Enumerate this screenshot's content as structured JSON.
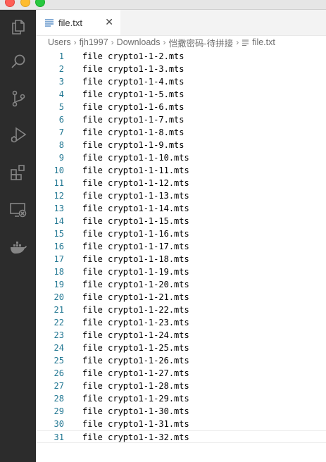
{
  "window": {
    "controls": [
      "close",
      "minimize",
      "maximize"
    ]
  },
  "activity_bar": {
    "icons": [
      "explorer-icon",
      "search-icon",
      "source-control-icon",
      "run-debug-icon",
      "extensions-icon",
      "remote-explorer-icon",
      "docker-icon"
    ]
  },
  "tab": {
    "label": "file.txt",
    "close_glyph": "✕"
  },
  "breadcrumb": {
    "items": [
      "Users",
      "fjh1997",
      "Downloads",
      "恺撒密码-待拼接",
      "file.txt"
    ],
    "separator": "›"
  },
  "editor": {
    "lines": [
      {
        "n": "1",
        "text": "file crypto1-1-2.mts"
      },
      {
        "n": "2",
        "text": "file crypto1-1-3.mts"
      },
      {
        "n": "3",
        "text": "file crypto1-1-4.mts"
      },
      {
        "n": "4",
        "text": "file crypto1-1-5.mts"
      },
      {
        "n": "5",
        "text": "file crypto1-1-6.mts"
      },
      {
        "n": "6",
        "text": "file crypto1-1-7.mts"
      },
      {
        "n": "7",
        "text": "file crypto1-1-8.mts"
      },
      {
        "n": "8",
        "text": "file crypto1-1-9.mts"
      },
      {
        "n": "9",
        "text": "file crypto1-1-10.mts"
      },
      {
        "n": "10",
        "text": "file crypto1-1-11.mts"
      },
      {
        "n": "11",
        "text": "file crypto1-1-12.mts"
      },
      {
        "n": "12",
        "text": "file crypto1-1-13.mts"
      },
      {
        "n": "13",
        "text": "file crypto1-1-14.mts"
      },
      {
        "n": "14",
        "text": "file crypto1-1-15.mts"
      },
      {
        "n": "15",
        "text": "file crypto1-1-16.mts"
      },
      {
        "n": "16",
        "text": "file crypto1-1-17.mts"
      },
      {
        "n": "17",
        "text": "file crypto1-1-18.mts"
      },
      {
        "n": "18",
        "text": "file crypto1-1-19.mts"
      },
      {
        "n": "19",
        "text": "file crypto1-1-20.mts"
      },
      {
        "n": "20",
        "text": "file crypto1-1-21.mts"
      },
      {
        "n": "21",
        "text": "file crypto1-1-22.mts"
      },
      {
        "n": "22",
        "text": "file crypto1-1-23.mts"
      },
      {
        "n": "23",
        "text": "file crypto1-1-24.mts"
      },
      {
        "n": "24",
        "text": "file crypto1-1-25.mts"
      },
      {
        "n": "25",
        "text": "file crypto1-1-26.mts"
      },
      {
        "n": "26",
        "text": "file crypto1-1-27.mts"
      },
      {
        "n": "27",
        "text": "file crypto1-1-28.mts"
      },
      {
        "n": "28",
        "text": "file crypto1-1-29.mts"
      },
      {
        "n": "29",
        "text": "file crypto1-1-30.mts"
      },
      {
        "n": "30",
        "text": "file crypto1-1-31.mts"
      },
      {
        "n": "31",
        "text": "file crypto1-1-32.mts"
      }
    ],
    "current_line": "31"
  },
  "colors": {
    "activity_bar": "#2c2c2c",
    "line_number": "#237893",
    "text": "#000000",
    "editor_bg": "#ffffff"
  }
}
